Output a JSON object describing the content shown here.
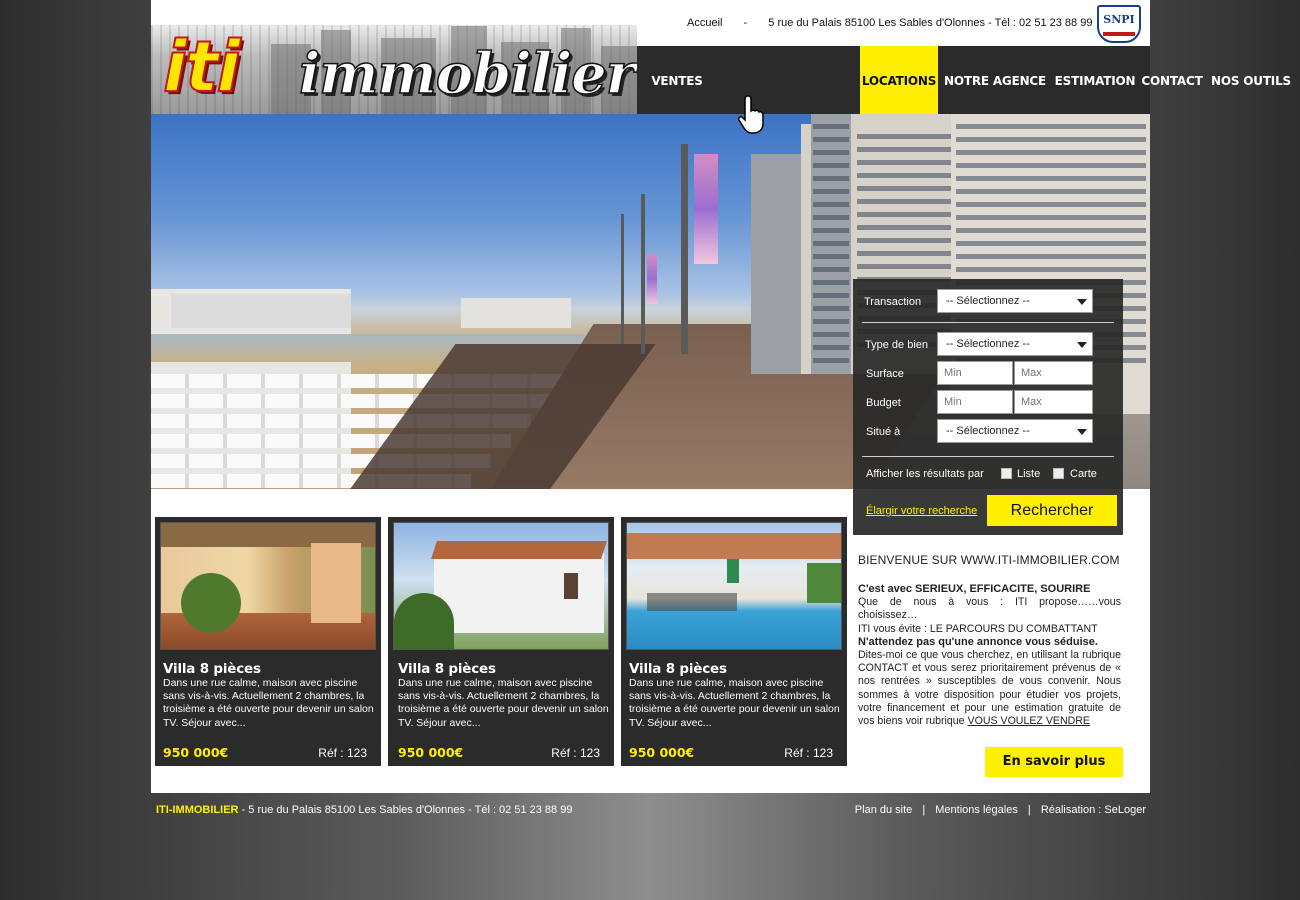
{
  "header": {
    "logo_word_1": "iti",
    "logo_word_2": "immobilier",
    "top_links": [
      "Accueil",
      "-",
      "5 rue du Palais 85100 Les Sables d'Olonnes  -  Tél : 02 51 23 88 99"
    ],
    "snpi_badge": "SNPI"
  },
  "nav": {
    "items": [
      "VENTES",
      "LOCATIONS",
      "NOTRE AGENCE",
      "ESTIMATION",
      "CONTACT",
      "NOS OUTILS"
    ],
    "active": "LOCATIONS"
  },
  "search": {
    "transaction_label": "Transaction",
    "transaction_value": "-- Sélectionnez --",
    "type_label": "Type de bien",
    "type_value": "-- Sélectionnez --",
    "surface_label": "Surface",
    "surface_min": "Min",
    "surface_max": "Max",
    "budget_label": "Budget",
    "budget_min": "Min",
    "budget_max": "Max",
    "location_label": "Situé à",
    "location_value": "-- Sélectionnez --",
    "display_label": "Afficher les résultats par",
    "option_list": "Liste",
    "option_map": "Carte",
    "expand_link": "Élargir votre recherche",
    "submit_label": "Rechercher"
  },
  "listings": [
    {
      "title": "Villa 8 pièces",
      "description": "Dans une rue calme, maison avec piscine sans vis-à-vis. Actuellement 2 chambres, la troisième a été ouverte pour devenir un salon TV. Séjour avec...",
      "price": "950 000€",
      "ref": "Réf : 123"
    },
    {
      "title": "Villa 8 pièces",
      "description": "Dans une rue calme, maison avec piscine sans vis-à-vis. Actuellement 2 chambres, la troisième a été ouverte pour devenir un salon TV. Séjour avec...",
      "price": "950 000€",
      "ref": "Réf : 123"
    },
    {
      "title": "Villa 8 pièces",
      "description": "Dans une rue calme, maison avec piscine sans vis-à-vis. Actuellement 2 chambres, la troisième a été ouverte pour devenir un salon TV. Séjour avec...",
      "price": "950 000€",
      "ref": "Réf : 123"
    }
  ],
  "welcome": {
    "title": "BIENVENUE SUR WWW.ITI-IMMOBILIER.COM",
    "heading_1": "C'est avec SERIEUX, EFFICACITE, SOURIRE",
    "text_1": "Que de nous à vous : ITI propose……vous choisissez…",
    "text_2": "ITI vous évite : LE PARCOURS DU COMBATTANT",
    "heading_2": "N'attendez pas qu'une annonce vous séduise.",
    "text_3": "Dites-moi ce que vous cherchez, en utilisant la rubrique CONTACT et vous serez prioritairement prévenus de « nos rentrées » susceptibles de vous convenir. Nous sommes à votre disposition pour étudier vos projets, votre financement et pour une estimation gratuite de vos biens voir rubrique ",
    "link_sell": "VOUS VOULEZ VENDRE",
    "more_button": "En savoir plus"
  },
  "footer": {
    "brand": "ITI-IMMOBILIER",
    "address": " - 5 rue du Palais 85100 Les Sables d'Olonnes  -  Tél : 02 51 23 88 99",
    "links": [
      "Plan du site",
      "Mentions légales",
      "Réalisation : SeLoger"
    ],
    "separator": "|"
  },
  "colors": {
    "accent_yellow": "#ffef00",
    "panel_dark": "#2b2b2b",
    "logo_red": "#c21a1a"
  }
}
